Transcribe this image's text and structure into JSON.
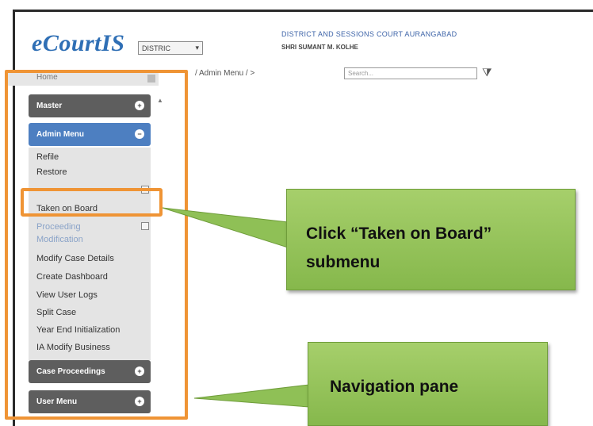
{
  "header": {
    "logo": "eCourtIS",
    "court_select": "DISTRIC",
    "court_name": "DISTRICT AND SESSIONS COURT AURANGABAD",
    "judge_name": "SHRI SUMANT M. KOLHE"
  },
  "toolbar": {
    "breadcrumb": "/ Admin Menu /  >",
    "search_placeholder": "Search..."
  },
  "nav": {
    "home_label": "Home",
    "master_label": "Master",
    "admin_label": "Admin Menu",
    "submenu_items": [
      "Refile",
      "Restore",
      "Taken on Board",
      "Proceeding",
      "Modification",
      "Modify Case Details",
      "Create Dashboard",
      "View User Logs",
      "Split Case",
      "Year End Initialization",
      "IA Modify Business"
    ],
    "case_proceedings_label": "Case Proceedings",
    "user_menu_label": "User Menu"
  },
  "callouts": {
    "taken_on_board_line1": "Click “Taken on Board”",
    "taken_on_board_line2": "submenu",
    "navigation_pane": "Navigation pane"
  },
  "colors": {
    "highlight_orange": "#ef9435",
    "callout_green": "#94c35a",
    "logo_blue": "#2f6fb5",
    "menu_blue": "#4d7fc1",
    "menu_dark": "#5e5e5e"
  }
}
